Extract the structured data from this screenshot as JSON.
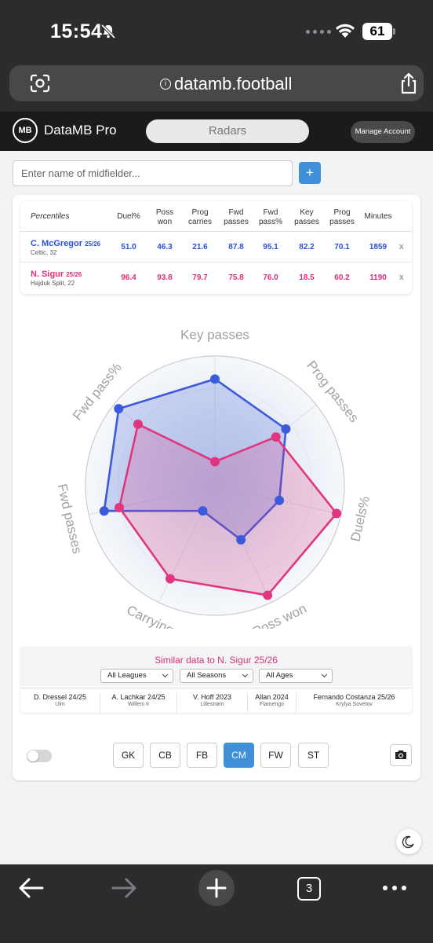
{
  "status_bar": {
    "time": "15:54",
    "battery": "61"
  },
  "browser": {
    "url": "datamb.football"
  },
  "header": {
    "brand": "DataMB Pro",
    "logo_text": "MB",
    "nav_active": "Radars",
    "manage_label": "Manage Account"
  },
  "search": {
    "placeholder": "Enter name of midfielder...",
    "add_label": "+"
  },
  "table": {
    "first_header": "Percentiles",
    "columns": [
      {
        "l1": "Duel%",
        "l2": ""
      },
      {
        "l1": "Poss",
        "l2": "won"
      },
      {
        "l1": "Prog",
        "l2": "carries"
      },
      {
        "l1": "Fwd",
        "l2": "passes"
      },
      {
        "l1": "Fwd",
        "l2": "pass%"
      },
      {
        "l1": "Key",
        "l2": "passes"
      },
      {
        "l1": "Prog",
        "l2": "passes"
      },
      {
        "l1": "Minutes",
        "l2": ""
      }
    ],
    "rows": [
      {
        "name": "C. McGregor",
        "season": "25/26",
        "club": "Celtic, 32",
        "values": [
          "51.0",
          "46.3",
          "21.6",
          "87.8",
          "95.1",
          "82.2",
          "70.1",
          "1859"
        ],
        "remove": "x",
        "color": "#2b4fd8"
      },
      {
        "name": "N. Sigur",
        "season": "25/26",
        "club": "Hajduk Split, 22",
        "values": [
          "96.4",
          "93.8",
          "79.7",
          "75.8",
          "76.0",
          "18.5",
          "60.2",
          "1190"
        ],
        "remove": "x",
        "color": "#de2f7b"
      }
    ]
  },
  "chart_data": {
    "type": "radar",
    "axes": [
      "Key passes",
      "Prog passes",
      "Duels%",
      "Poss won",
      "Carrying",
      "Fwd passes",
      "Fwd pass%"
    ],
    "range": [
      0,
      100
    ],
    "series": [
      {
        "name": "C. McGregor 25/26",
        "color": "#3b5bdb",
        "values": [
          82.2,
          70.1,
          51.0,
          46.3,
          21.6,
          87.8,
          95.1
        ]
      },
      {
        "name": "N. Sigur 25/26",
        "color": "#e0367f",
        "values": [
          18.5,
          60.2,
          96.4,
          93.8,
          79.7,
          75.8,
          76.0
        ]
      }
    ]
  },
  "similar": {
    "title": "Similar data to N. Sigur 25/26",
    "filters": [
      "All Leagues",
      "All Seasons",
      "All Ages"
    ],
    "players": [
      {
        "name": "D. Dressel 24/25",
        "club": "Ulm"
      },
      {
        "name": "A. Lachkar 24/25",
        "club": "Willem II"
      },
      {
        "name": "V. Hoff 2023",
        "club": "Lillestrøm"
      },
      {
        "name": "Allan 2024",
        "club": "Flamengo"
      },
      {
        "name": "Fernando Costanza 25/26",
        "club": "Krylya Sovetov"
      }
    ]
  },
  "positions": {
    "buttons": [
      "GK",
      "CB",
      "FB",
      "CM",
      "FW",
      "ST"
    ],
    "active": "CM"
  },
  "bottom_bar": {
    "tabs_count": "3"
  }
}
